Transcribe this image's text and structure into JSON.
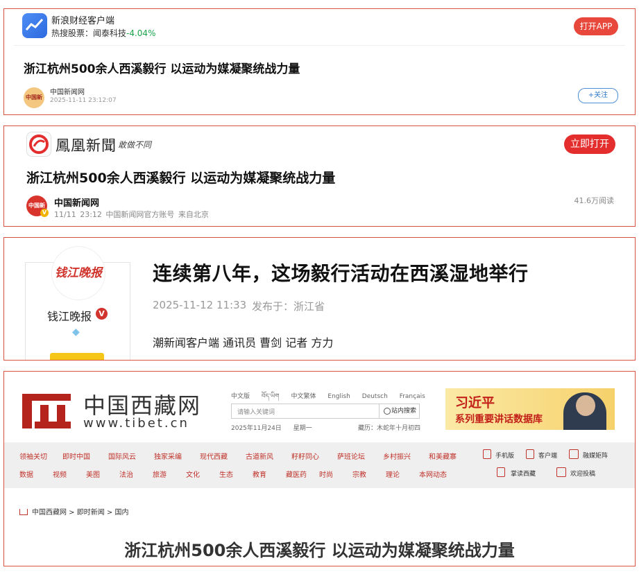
{
  "sina": {
    "app_name": "新浪财经客户端",
    "hot_label": "热搜股票：闻泰科技",
    "hot_change": "-4.04%",
    "open_app": "打开APP",
    "title": "浙江杭州500余人西溪毅行 以运动为媒凝聚统战力量",
    "source_logo": "中国新闻",
    "source": "中国新闻网",
    "time": "2025-11-11 23:12:07",
    "follow": "+关注"
  },
  "ifeng": {
    "name": "鳳凰新聞",
    "slogan": "敢做不同",
    "open_now": "立即打开",
    "title": "浙江杭州500余人西溪毅行 以运动为媒凝聚统战力量",
    "source_logo": "中国新闻",
    "source": "中国新闻网",
    "meta": "11/11 23:12  中国新闻网官方账号  来自北京",
    "reads": "41.6万阅读"
  },
  "qianjiang": {
    "logo_text": "钱江晚报",
    "media_name": "钱江晚报",
    "headline": "连续第八年，这场毅行活动在西溪湿地举行",
    "pubdate": "2025-11-12 11:33",
    "publoc": "发布于：浙江省",
    "byline": "潮新闻客户端 通讯员 曹剑 记者 方力"
  },
  "tibet": {
    "site_name": "中国西藏网",
    "site_url": "www.tibet.cn",
    "languages": [
      "中文版",
      "བོད་ཡིག",
      "中文繁体",
      "English",
      "Deutsch",
      "Français"
    ],
    "search_placeholder": "请输入关键词",
    "search_button": "站内搜索",
    "date": "2025年11月24日",
    "weekday": "星期一",
    "tibetan_date": "藏历：木蛇年十月初四",
    "banner_line1": "习近平",
    "banner_line2": "系列重要讲话数据库",
    "nav_row1": [
      "领袖关切",
      "即时中国",
      "国际风云",
      "独家采编",
      "现代西藏",
      "古道新风",
      "籽籽同心",
      "萨班论坛",
      "乡村振兴",
      "和美藏寨"
    ],
    "nav_row2": [
      "数据",
      "视频",
      "美图",
      "法治",
      "旅游",
      "文化",
      "生态",
      "教育",
      "藏医药",
      "时尚",
      "宗教",
      "理论",
      "本网动态"
    ],
    "nav_extra": [
      "手机版",
      "客户端",
      "融媒矩阵",
      "掌读西藏",
      "欢迎投稿"
    ],
    "breadcrumb": "中国西藏网 > 即时新闻 > 国内",
    "title": "浙江杭州500余人西溪毅行 以运动为媒凝聚统战力量"
  },
  "colors": {
    "panel_border": "#d9533f",
    "accent_red": "#e8473b",
    "tibet_red": "#c0322a",
    "sina_blue": "#2d6be0",
    "down_green": "#1aa34a"
  }
}
